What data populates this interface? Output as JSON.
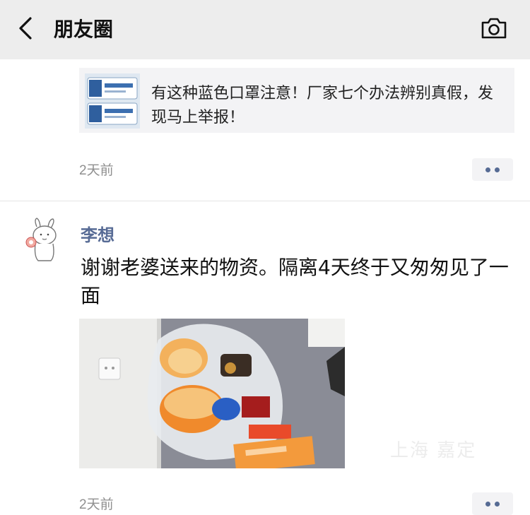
{
  "header": {
    "back_icon": "chevron-left-icon",
    "title": "朋友圈",
    "camera_icon": "camera-icon",
    "background": "#ededed"
  },
  "post1": {
    "share_card": {
      "thumbnail_icon": "mask-package-thumbnail",
      "text": "有这种蓝色口罩注意！厂家七个办法辨别真假，发现马上举报！"
    },
    "time": "2天前",
    "more_icon": "more-dots-icon"
  },
  "post2": {
    "avatar_icon": "cartoon-rabbit-avatar",
    "username": "李想",
    "text": "谢谢老婆送来的物资。隔离4天终于又匆匆见了一面",
    "photo_icon": "supplies-bag-photo",
    "watermark": "上海 嘉定",
    "time": "2天前",
    "more_icon": "more-dots-icon"
  },
  "colors": {
    "name_blue": "#576b95",
    "time_gray": "#8f8f8f",
    "card_bg": "#f3f3f5"
  }
}
